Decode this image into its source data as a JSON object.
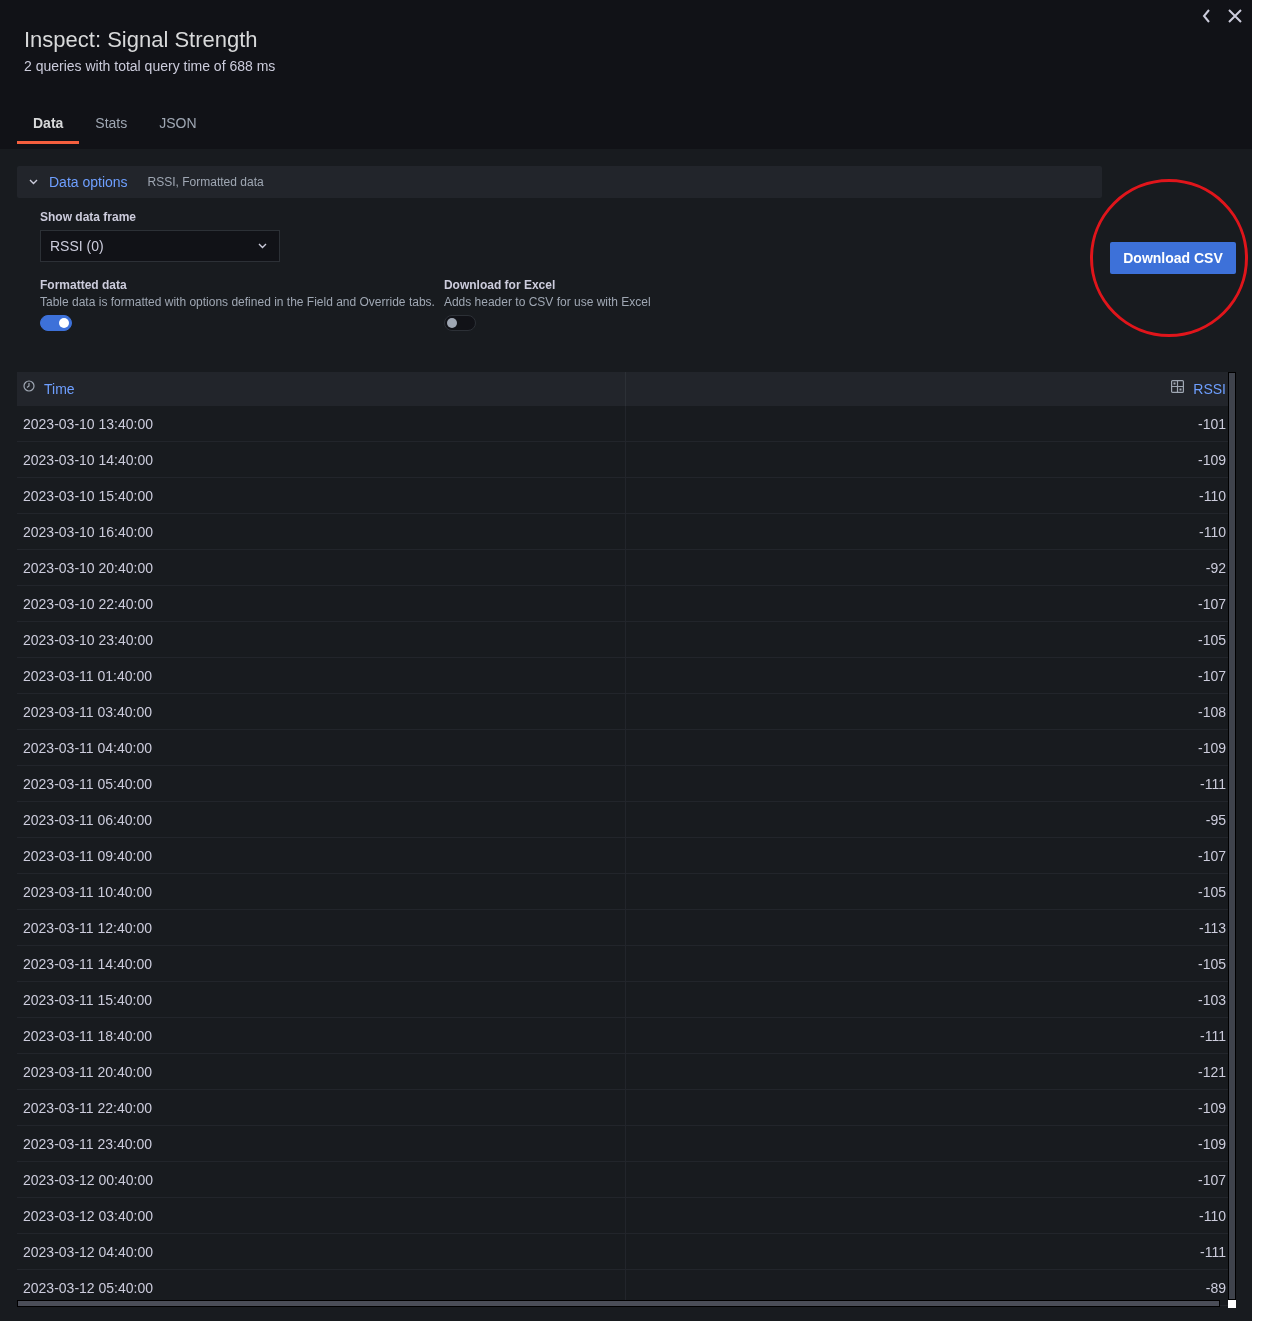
{
  "header": {
    "title": "Inspect: Signal Strength",
    "subtitle": "2 queries with total query time of 688 ms"
  },
  "tabs": [
    {
      "label": "Data",
      "selected": true
    },
    {
      "label": "Stats",
      "selected": false
    },
    {
      "label": "JSON",
      "selected": false
    }
  ],
  "data_options": {
    "label": "Data options",
    "summary": "RSSI, Formatted data",
    "expanded": true
  },
  "data_frame": {
    "label": "Show data frame",
    "value": "RSSI (0)"
  },
  "toggles": [
    {
      "label": "Formatted data",
      "description": "Table data is formatted with options defined in the Field and Override tabs.",
      "on": true
    },
    {
      "label": "Download for Excel",
      "description": "Adds header to CSV for use with Excel",
      "on": false
    }
  ],
  "download_button": {
    "label": "Download CSV",
    "highlighted": true
  },
  "table": {
    "columns": [
      {
        "label": "Time",
        "kind": "time"
      },
      {
        "label": "RSSI",
        "kind": "number"
      }
    ],
    "rows": [
      [
        "2023-03-10 13:40:00",
        "-101"
      ],
      [
        "2023-03-10 14:40:00",
        "-109"
      ],
      [
        "2023-03-10 15:40:00",
        "-110"
      ],
      [
        "2023-03-10 16:40:00",
        "-110"
      ],
      [
        "2023-03-10 20:40:00",
        "-92"
      ],
      [
        "2023-03-10 22:40:00",
        "-107"
      ],
      [
        "2023-03-10 23:40:00",
        "-105"
      ],
      [
        "2023-03-11 01:40:00",
        "-107"
      ],
      [
        "2023-03-11 03:40:00",
        "-108"
      ],
      [
        "2023-03-11 04:40:00",
        "-109"
      ],
      [
        "2023-03-11 05:40:00",
        "-111"
      ],
      [
        "2023-03-11 06:40:00",
        "-95"
      ],
      [
        "2023-03-11 09:40:00",
        "-107"
      ],
      [
        "2023-03-11 10:40:00",
        "-105"
      ],
      [
        "2023-03-11 12:40:00",
        "-113"
      ],
      [
        "2023-03-11 14:40:00",
        "-105"
      ],
      [
        "2023-03-11 15:40:00",
        "-103"
      ],
      [
        "2023-03-11 18:40:00",
        "-111"
      ],
      [
        "2023-03-11 20:40:00",
        "-121"
      ],
      [
        "2023-03-11 22:40:00",
        "-109"
      ],
      [
        "2023-03-11 23:40:00",
        "-109"
      ],
      [
        "2023-03-12 00:40:00",
        "-107"
      ],
      [
        "2023-03-12 03:40:00",
        "-110"
      ],
      [
        "2023-03-12 04:40:00",
        "-111"
      ],
      [
        "2023-03-12 05:40:00",
        "-89"
      ]
    ]
  }
}
